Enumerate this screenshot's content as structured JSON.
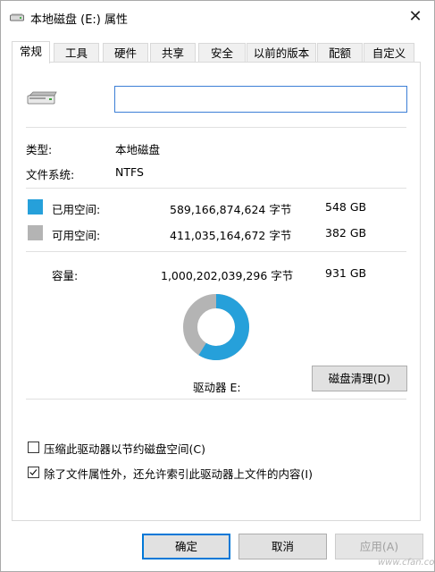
{
  "window": {
    "title": "本地磁盘 (E:) 属性",
    "icons": {
      "title": "drive-icon",
      "close": "close-icon"
    },
    "close_glyph": "✕"
  },
  "tabs": [
    {
      "label": "常规",
      "active": true
    },
    {
      "label": "工具",
      "active": false
    },
    {
      "label": "硬件",
      "active": false
    },
    {
      "label": "共享",
      "active": false
    },
    {
      "label": "安全",
      "active": false
    },
    {
      "label": "以前的版本",
      "active": false
    },
    {
      "label": "配额",
      "active": false
    },
    {
      "label": "自定义",
      "active": false
    }
  ],
  "general": {
    "volume_label": {
      "value": "",
      "placeholder": ""
    },
    "type": {
      "label": "类型:",
      "value": "本地磁盘"
    },
    "filesystem": {
      "label": "文件系统:",
      "value": "NTFS"
    },
    "used": {
      "label": "已用空间:",
      "bytes": "589,166,874,624 字节",
      "size": "548 GB",
      "color": "#26a0da"
    },
    "free": {
      "label": "可用空间:",
      "bytes": "411,035,164,672 字节",
      "size": "382 GB",
      "color": "#b4b4b4"
    },
    "capacity": {
      "label": "容量:",
      "bytes": "1,000,202,039,296 字节",
      "size": "931 GB"
    },
    "chart": {
      "used_fraction": 0.589
    },
    "drive_label": "驱动器 E:",
    "cleanup_button": "磁盘清理(D)",
    "compress_checkbox": {
      "label": "压缩此驱动器以节约磁盘空间(C)",
      "checked": false
    },
    "index_checkbox": {
      "label": "除了文件属性外，还允许索引此驱动器上文件的内容(I)",
      "checked": true
    }
  },
  "buttons": {
    "ok": "确定",
    "cancel": "取消",
    "apply": "应用(A)"
  },
  "watermark": "www.cfan.com.cn"
}
